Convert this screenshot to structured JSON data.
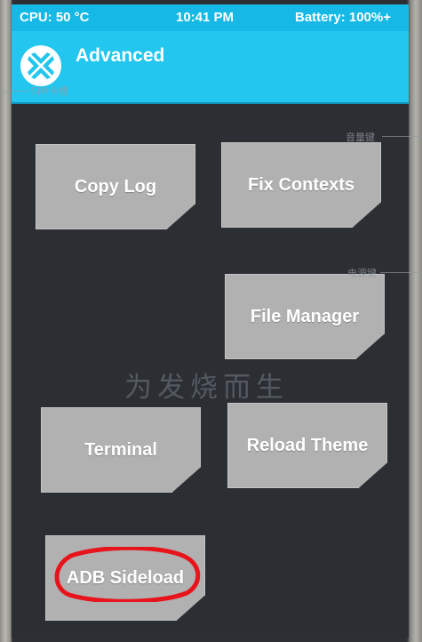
{
  "status_bar": {
    "cpu": "CPU: 50 °C",
    "time": "10:41 PM",
    "battery": "Battery: 100%+"
  },
  "header": {
    "title": "Advanced",
    "logo_icon": "twrp-logo-icon"
  },
  "buttons": {
    "copy_log": "Copy Log",
    "fix_contexts": "Fix Contexts",
    "file_manager": "File Manager",
    "terminal": "Terminal",
    "reload_theme": "Reload Theme",
    "adb_sideload": "ADB Sideload"
  },
  "overlay": {
    "watermark": "为发烧而生",
    "side_labels": {
      "sim": "SIM卡槽",
      "volume": "音量键",
      "power": "电源键"
    },
    "annotation_color": "#e8141c"
  },
  "colors": {
    "accent": "#22c6ee",
    "statusbar": "#16b9e6",
    "background": "#2b2e33",
    "button": "#b1b1b1"
  }
}
